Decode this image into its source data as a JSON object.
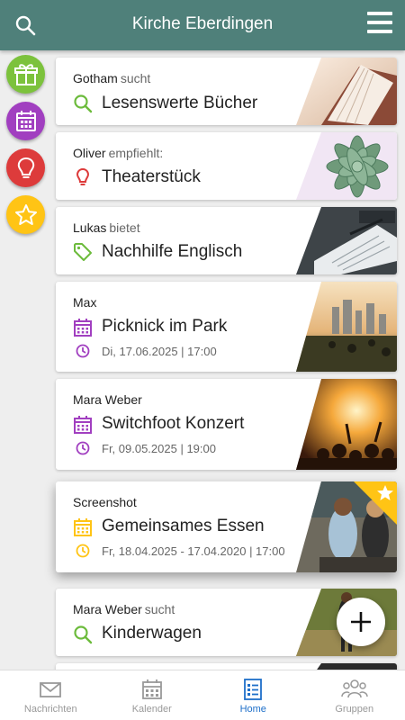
{
  "header": {
    "title": "Kirche Eberdingen",
    "search_icon": "search-icon",
    "menu_icon": "hamburger-menu-icon"
  },
  "sidebar": [
    {
      "name": "gift",
      "icon": "gift-icon",
      "color": "#7cc23c"
    },
    {
      "name": "calendar",
      "icon": "calendar-icon",
      "color": "#a13fc0"
    },
    {
      "name": "idea",
      "icon": "lightbulb-icon",
      "color": "#dd3b3b"
    },
    {
      "name": "favorites",
      "icon": "star-icon",
      "color": "#ffc415"
    }
  ],
  "cards": [
    {
      "author": "Gotham",
      "verb": "sucht",
      "title": "Lesenswerte Bücher",
      "icon": "search-icon",
      "icon_color": "#6cbb3c"
    },
    {
      "author": "Oliver",
      "verb": "empfiehlt:",
      "title": "Theaterstück",
      "icon": "lightbulb-icon",
      "icon_color": "#dd3b3b"
    },
    {
      "author": "Lukas",
      "verb": "bietet",
      "title": "Nachhilfe Englisch",
      "icon": "tag-icon",
      "icon_color": "#6cbb3c"
    },
    {
      "author": "Max",
      "verb": "",
      "title": "Picknick im Park",
      "icon": "calendar-icon",
      "icon_color": "#a13fc0",
      "date": "Di, 17.06.2025 | 17:00"
    },
    {
      "author": "Mara Weber",
      "verb": "",
      "title": "Switchfoot Konzert",
      "icon": "calendar-icon",
      "icon_color": "#a13fc0",
      "date": "Fr, 09.05.2025 | 19:00"
    },
    {
      "author": "Screenshot",
      "verb": "",
      "title": "Gemeinsames Essen",
      "icon": "calendar-icon",
      "icon_color": "#ffc415",
      "date": "Fr, 18.04.2025 - 17.04.2020 | 17:00",
      "favorite": true
    },
    {
      "author": "Mara Weber",
      "verb": "sucht",
      "title": "Kinderwagen",
      "icon": "search-icon",
      "icon_color": "#6cbb3c"
    }
  ],
  "fab": {
    "icon": "plus-icon"
  },
  "bottom_nav": [
    {
      "label": "Nachrichten",
      "icon": "mail-icon",
      "active": false
    },
    {
      "label": "Kalender",
      "icon": "calendar-icon",
      "active": false
    },
    {
      "label": "Home",
      "icon": "list-icon",
      "active": true
    },
    {
      "label": "Gruppen",
      "icon": "group-icon",
      "active": false
    }
  ]
}
